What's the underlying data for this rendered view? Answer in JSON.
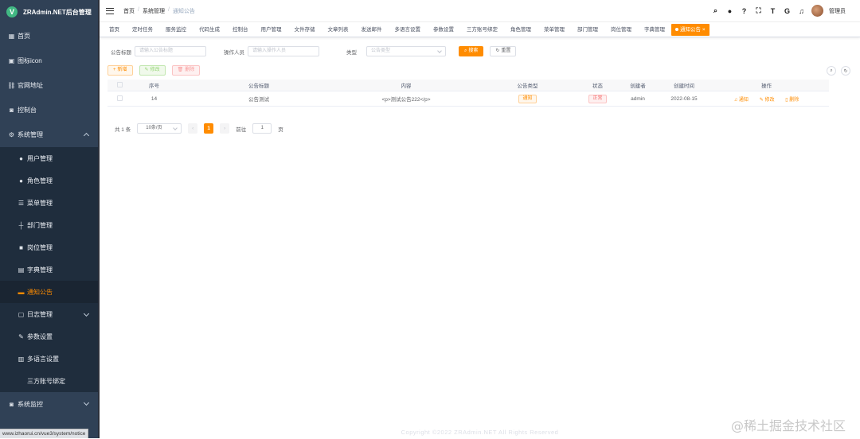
{
  "app": {
    "title": "ZRAdmin.NET后台管理"
  },
  "sidebar": {
    "items": [
      {
        "label": "首页",
        "icon": "dashboard-icon"
      },
      {
        "label": "图标icon",
        "icon": "icon-icon"
      },
      {
        "label": "官网地址",
        "icon": "link-icon"
      },
      {
        "label": "控制台",
        "icon": "monitor-icon"
      },
      {
        "label": "系统管理",
        "icon": "gear-icon"
      }
    ],
    "sub_items": [
      {
        "label": "用户管理",
        "icon": "user-icon"
      },
      {
        "label": "角色管理",
        "icon": "peoples-icon"
      },
      {
        "label": "菜单管理",
        "icon": "tree-table-icon"
      },
      {
        "label": "部门管理",
        "icon": "tree-icon"
      },
      {
        "label": "岗位管理",
        "icon": "post-icon"
      },
      {
        "label": "字典管理",
        "icon": "dict-icon"
      },
      {
        "label": "通知公告",
        "icon": "message-icon"
      },
      {
        "label": "日志管理",
        "icon": "log-icon"
      },
      {
        "label": "参数设置",
        "icon": "edit-icon"
      },
      {
        "label": "多语言设置",
        "icon": "language-icon"
      },
      {
        "label": "三方账号绑定",
        "icon": "link-icon"
      }
    ],
    "bottom_item": {
      "label": "系统监控",
      "icon": "monitor-icon"
    },
    "status_url": "www.izhaorui.cn/vue3/system/notice"
  },
  "breadcrumb": [
    "首页",
    "系统管理",
    "通知公告"
  ],
  "header": {
    "username": "管理员"
  },
  "tags": [
    "首页",
    "定时任务",
    "服务监控",
    "代码生成",
    "控制台",
    "用户管理",
    "文件存储",
    "文章列表",
    "发送邮件",
    "多语言设置",
    "参数设置",
    "三方账号绑定",
    "角色管理",
    "菜单管理",
    "部门管理",
    "岗位管理",
    "字典管理",
    "通知公告"
  ],
  "search": {
    "title_label": "公告标题",
    "title_placeholder": "请输入公告标题",
    "operator_label": "操作人员",
    "operator_placeholder": "请输入操作人员",
    "type_label": "类型",
    "type_placeholder": "公告类型",
    "search_btn": "搜索",
    "reset_btn": "重置"
  },
  "toolbar": {
    "add": "新增",
    "edit": "修改",
    "delete": "删除"
  },
  "table": {
    "columns": [
      "序号",
      "公告标题",
      "内容",
      "公告类型",
      "状态",
      "创建者",
      "创建时间",
      "操作"
    ],
    "rows": [
      {
        "id": "14",
        "title": "公告测试",
        "content": "<p>测试公告222</p>",
        "type": "通知",
        "status": "正常",
        "creator": "admin",
        "created": "2022-08-15",
        "ops": [
          "通知",
          "修改",
          "删除"
        ]
      }
    ]
  },
  "pager": {
    "total": "共 1 条",
    "size": "10条/页",
    "page": "1",
    "goto_label": "前往",
    "goto_value": "1",
    "page_unit": "页"
  },
  "footer": "Copyright ©2022 ZRAdmin.NET All Rights Reserved",
  "watermark": "@稀土掘金技术社区",
  "colors": {
    "accent": "#ff8c00",
    "sidebar": "#304156"
  }
}
